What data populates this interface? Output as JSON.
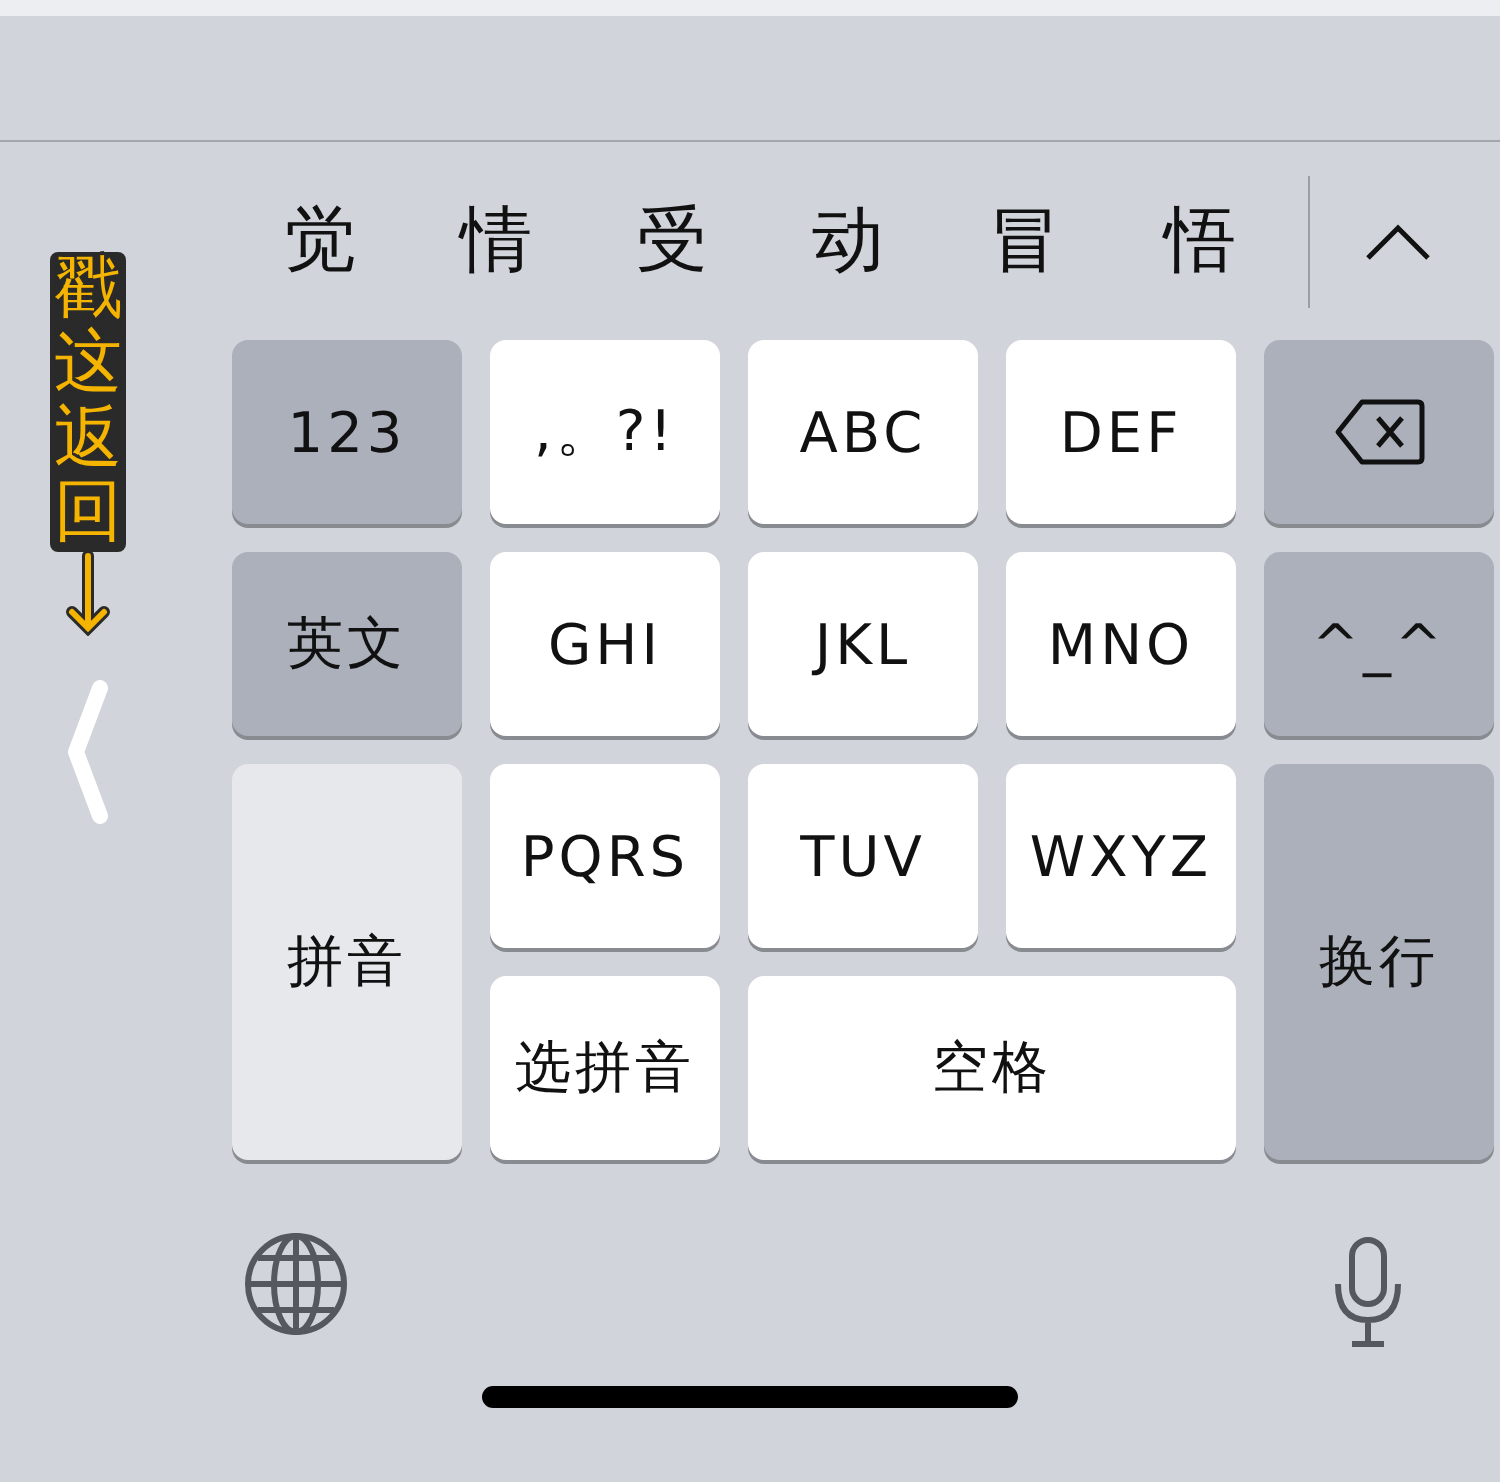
{
  "candidates": [
    "觉",
    "情",
    "受",
    "动",
    "冒",
    "悟"
  ],
  "annotation": {
    "text": "戳这返回"
  },
  "keys": [
    {
      "kind": "function",
      "label": "123"
    },
    {
      "kind": "letter",
      "label": ",。?!"
    },
    {
      "kind": "letter",
      "label": "ABC"
    },
    {
      "kind": "letter",
      "label": "DEF"
    },
    {
      "kind": "delete"
    },
    {
      "kind": "function",
      "label": "英文"
    },
    {
      "kind": "letter",
      "label": "GHI"
    },
    {
      "kind": "letter",
      "label": "JKL"
    },
    {
      "kind": "letter",
      "label": "MNO"
    },
    {
      "kind": "function",
      "label": "^_^"
    },
    {
      "kind": "light",
      "label": "拼音"
    },
    {
      "kind": "letter",
      "label": "PQRS"
    },
    {
      "kind": "letter",
      "label": "TUV"
    },
    {
      "kind": "letter",
      "label": "WXYZ"
    },
    {
      "kind": "function",
      "label": "换行"
    },
    {
      "kind": "letter",
      "label": "选拼音"
    },
    {
      "kind": "letter",
      "label": "空格"
    }
  ]
}
